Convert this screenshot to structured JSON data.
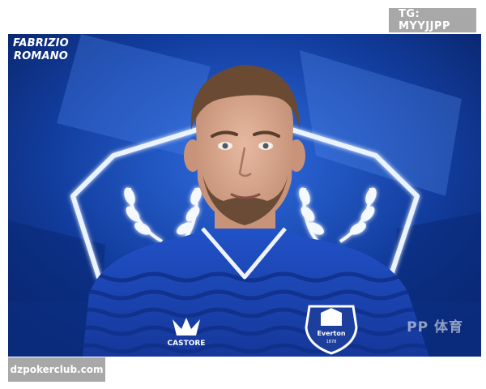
{
  "overlay": {
    "tag_text": "TG: MYYJJPP",
    "site_text": "dzpokerclub.com"
  },
  "photo": {
    "reporter_line1": "FABRIZIO",
    "reporter_line2": "ROMANO",
    "kit_brand": "CASTORE",
    "crest_text": "Everton",
    "crest_year": "1878",
    "watermark": "PP 体育",
    "colors": {
      "background": "#0b2e8f",
      "glow": "#e8f2ff",
      "shirt": "#1a46b8",
      "shirt_stripe": "#143a9c"
    }
  }
}
